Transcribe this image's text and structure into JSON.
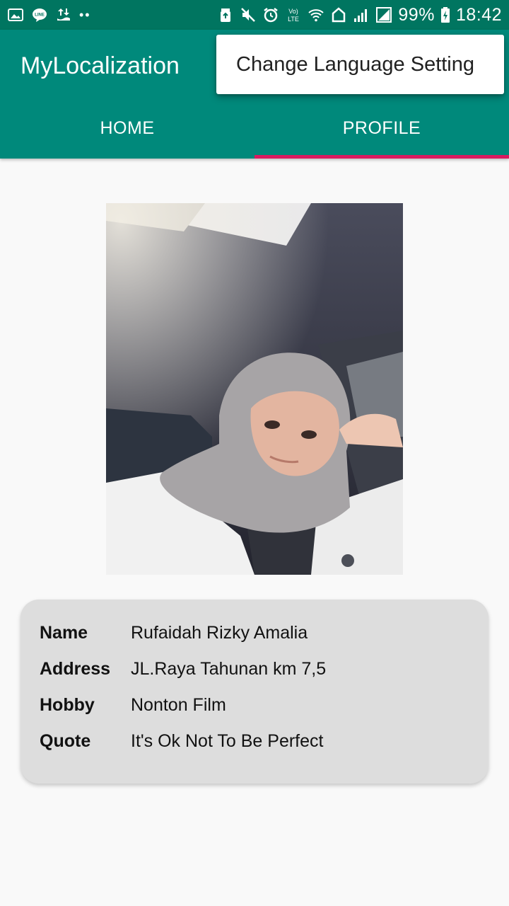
{
  "status_bar": {
    "battery": "99%",
    "time": "18:42",
    "left_icons": [
      "gallery-icon",
      "line-icon",
      "upload-icon",
      "more-dots-icon"
    ],
    "right_icons": [
      "recycle-icon",
      "mute-icon",
      "alarm-icon",
      "volte-icon",
      "wifi-icon",
      "home-icon",
      "signal-icon",
      "signal-box-icon",
      "battery-icon"
    ]
  },
  "app_bar": {
    "title": "MyLocalization",
    "tabs": [
      {
        "label": "HOME",
        "selected": false
      },
      {
        "label": "PROFILE",
        "selected": true
      }
    ]
  },
  "overflow_menu": {
    "items": [
      "Change Language Setting"
    ]
  },
  "profile": {
    "photo": "profile-photo",
    "fields": [
      {
        "key": "Name",
        "value": "Rufaidah Rizky Amalia"
      },
      {
        "key": "Address",
        "value": "JL.Raya Tahunan km 7,5"
      },
      {
        "key": "Hobby",
        "value": "Nonton Film"
      },
      {
        "key": "Quote",
        "value": "It's Ok Not To Be Perfect"
      }
    ]
  },
  "colors": {
    "status_bar": "#007560",
    "primary": "#00897b",
    "accent": "#d81b60",
    "background": "#f9f9f9",
    "card": "#dddddd"
  }
}
